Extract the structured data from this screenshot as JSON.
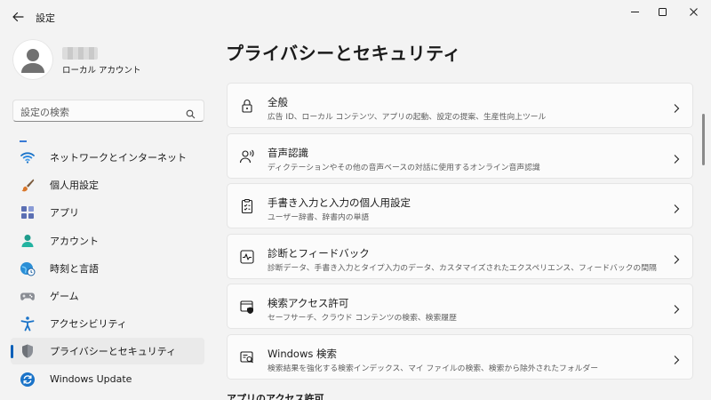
{
  "window": {
    "title": "設定"
  },
  "profile": {
    "account_type": "ローカル アカウント"
  },
  "search": {
    "placeholder": "設定の検索"
  },
  "nav": {
    "items": [
      {
        "label": "ネットワークとインターネット",
        "icon": "wifi-icon"
      },
      {
        "label": "個人用設定",
        "icon": "brush-icon"
      },
      {
        "label": "アプリ",
        "icon": "apps-icon"
      },
      {
        "label": "アカウント",
        "icon": "person-icon"
      },
      {
        "label": "時刻と言語",
        "icon": "globe-clock-icon"
      },
      {
        "label": "ゲーム",
        "icon": "gamepad-icon"
      },
      {
        "label": "アクセシビリティ",
        "icon": "accessibility-icon"
      },
      {
        "label": "プライバシーとセキュリティ",
        "icon": "shield-icon",
        "active": true
      },
      {
        "label": "Windows Update",
        "icon": "update-icon"
      }
    ]
  },
  "main": {
    "title": "プライバシーとセキュリティ",
    "cards": [
      {
        "title": "全般",
        "subtitle": "広告 ID、ローカル コンテンツ、アプリの起動、設定の提案、生産性向上ツール",
        "icon": "lock-icon"
      },
      {
        "title": "音声認識",
        "subtitle": "ディクテーションやその他の音声ベースの対話に使用するオンライン音声認識",
        "icon": "speech-icon"
      },
      {
        "title": "手書き入力と入力の個人用設定",
        "subtitle": "ユーザー辞書、辞書内の単語",
        "icon": "clipboard-icon"
      },
      {
        "title": "診断とフィードバック",
        "subtitle": "診断データ、手書き入力とタイプ入力のデータ、カスタマイズされたエクスペリエンス、フィードバックの間隔",
        "icon": "pulse-icon"
      },
      {
        "title": "検索アクセス許可",
        "subtitle": "セーフサーチ、クラウド コンテンツの検索、検索履歴",
        "icon": "search-shield-icon"
      },
      {
        "title": "Windows 検索",
        "subtitle": "検索結果を強化する検索インデックス、マイ ファイルの検索、検索から除外されたフォルダー",
        "icon": "search-doc-icon"
      }
    ],
    "section_label": "アプリのアクセス許可"
  },
  "colors": {
    "accent": "#005fb8",
    "background": "#f3f3f3",
    "card": "#fbfbfb"
  }
}
